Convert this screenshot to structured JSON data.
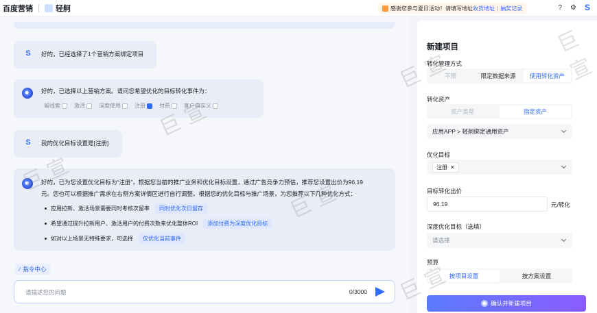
{
  "topbar": {
    "brand": "百度营销",
    "sub_brand": "轻舸",
    "notice_prefix": "感谢您参与夏日活动！请填写地址",
    "notice_link1": "收货地址",
    "notice_divider": "|",
    "notice_link2": "抽奖记录",
    "user_initial": "S"
  },
  "chat": {
    "msg1": {
      "avatar": "S",
      "text": "好的，已经选择了1个营销方案绑定项目"
    },
    "msg2": {
      "text": "好的，已选择以上营销方案。请问您希望优化的目标转化事件为：",
      "options": [
        {
          "label": "留线索",
          "checked": false
        },
        {
          "label": "激活",
          "checked": false
        },
        {
          "label": "深度使用",
          "checked": false
        },
        {
          "label": "注册",
          "checked": true
        },
        {
          "label": "付费",
          "checked": false
        },
        {
          "label": "客户自定义",
          "checked": false
        }
      ]
    },
    "msg3": {
      "avatar": "S",
      "text": "我的优化目标设置是[注册]"
    },
    "msg4": {
      "line1": "好的，已为您设置优化目标为“注册”，根据您当前的推广业务和优化目标设置，通过广告竞争力预估，推荐您设置出价为96.19",
      "line2": "元。您也可以根据推广需求在右侧方案详情区进行自行调整。根据您的优化目标与推广场景，为您推荐以下几种优化方式：",
      "tips": [
        {
          "text": "应用拉新、激活场景需要同时考核次留率",
          "tag": "同时优化次日留存"
        },
        {
          "text": "希望通过提升拉新用户、激活用户的付费次数来优化整体ROI",
          "tag": "添加付费为深度优化目标"
        },
        {
          "text": "如对以上场景无特殊要求，可选择",
          "tag": "仅优化当前事件"
        }
      ]
    },
    "command_center": "指令中心",
    "input_placeholder": "请描述您的问题",
    "input_count": "0/3000"
  },
  "panel": {
    "title": "新建项目",
    "opt_mode_label": "转化管理方式",
    "opt_mode_tabs": [
      {
        "label": "不限",
        "state": "disabled"
      },
      {
        "label": "限定数据来源",
        "state": "normal"
      },
      {
        "label": "使用转化资产",
        "state": "active"
      }
    ],
    "asset_label": "转化资产",
    "asset_tabs": [
      {
        "label": "资产类型",
        "state": "disabled"
      },
      {
        "label": "指定资产",
        "state": "active"
      }
    ],
    "asset_select": "应用APP > 轻舸绑定通用资产",
    "goal_label": "优化目标",
    "goal_chip": "注册",
    "bid_label": "目标转化出价",
    "bid_value": "96.19",
    "bid_unit": "元/转化",
    "deep_label": "深度优化目标（选填）",
    "deep_placeholder": "请选择",
    "budget_label": "预算",
    "budget_tabs": [
      {
        "label": "按项目设置",
        "state": "active"
      },
      {
        "label": "按方案设置",
        "state": "normal"
      }
    ],
    "confirm_button": "确认并新建项目"
  },
  "watermark": "巨 宣"
}
